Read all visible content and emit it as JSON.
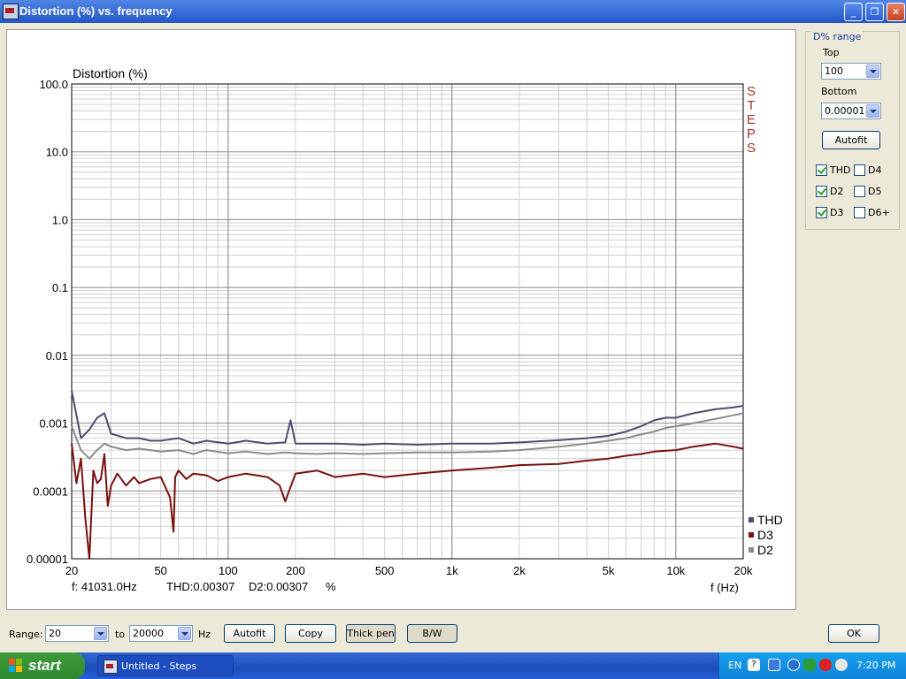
{
  "window": {
    "title": "Distortion (%) vs. frequency"
  },
  "plot": {
    "vertical_watermark": [
      "S",
      "T",
      "E",
      "P",
      "S"
    ],
    "status_freq": "f: 41031.0Hz",
    "status_thd": "THD:0.00307",
    "status_d2": "D2:0.00307",
    "status_unit": "%",
    "legend": [
      {
        "name": "THD",
        "color": "#4b4e6e"
      },
      {
        "name": "D3",
        "color": "#7a1010"
      },
      {
        "name": "D2",
        "color": "#8c8c8c"
      }
    ]
  },
  "chart_data": {
    "type": "line",
    "title": "",
    "ylabel": "Distortion (%)",
    "xlabel": "f (Hz)",
    "x_scale": "log",
    "y_scale": "log",
    "xlim": [
      20,
      20000
    ],
    "ylim": [
      1e-05,
      100
    ],
    "grid": true,
    "legend_position": "bottom-right",
    "x_ticks": [
      {
        "v": 20,
        "label": "20"
      },
      {
        "v": 50,
        "label": "50"
      },
      {
        "v": 100,
        "label": "100"
      },
      {
        "v": 200,
        "label": "200"
      },
      {
        "v": 500,
        "label": "500"
      },
      {
        "v": 1000,
        "label": "1k"
      },
      {
        "v": 2000,
        "label": "2k"
      },
      {
        "v": 5000,
        "label": "5k"
      },
      {
        "v": 10000,
        "label": "10k"
      },
      {
        "v": 20000,
        "label": "20k"
      }
    ],
    "y_ticks": [
      {
        "v": 100,
        "label": "100.0"
      },
      {
        "v": 10,
        "label": "10.0"
      },
      {
        "v": 1,
        "label": "1.0"
      },
      {
        "v": 0.1,
        "label": "0.1"
      },
      {
        "v": 0.01,
        "label": "0.01"
      },
      {
        "v": 0.001,
        "label": "0.001"
      },
      {
        "v": 0.0001,
        "label": "0.0001"
      },
      {
        "v": 1e-05,
        "label": "0.00001"
      }
    ],
    "series": [
      {
        "name": "D2",
        "color": "#8c8c8c",
        "x": [
          20,
          22,
          24,
          26,
          28,
          30,
          35,
          40,
          45,
          50,
          60,
          70,
          80,
          100,
          120,
          150,
          180,
          200,
          250,
          300,
          400,
          500,
          700,
          1000,
          1500,
          2000,
          3000,
          4000,
          5000,
          6000,
          7000,
          8000,
          9000,
          10000,
          12000,
          15000,
          18000,
          20000
        ],
        "y": [
          0.0009,
          0.0004,
          0.0003,
          0.0004,
          0.0005,
          0.00045,
          0.0004,
          0.00042,
          0.0004,
          0.00038,
          0.0004,
          0.00035,
          0.0004,
          0.00036,
          0.00038,
          0.00035,
          0.00037,
          0.00036,
          0.00035,
          0.00036,
          0.00035,
          0.00036,
          0.00037,
          0.00037,
          0.00038,
          0.0004,
          0.00045,
          0.0005,
          0.00055,
          0.0006,
          0.00068,
          0.00075,
          0.00085,
          0.0009,
          0.001,
          0.00115,
          0.0013,
          0.0014
        ]
      },
      {
        "name": "THD",
        "color": "#4b4e6e",
        "x": [
          20,
          22,
          24,
          26,
          28,
          30,
          35,
          40,
          45,
          50,
          60,
          70,
          80,
          100,
          120,
          150,
          180,
          190,
          200,
          250,
          300,
          400,
          500,
          700,
          1000,
          1500,
          2000,
          3000,
          4000,
          5000,
          6000,
          7000,
          8000,
          9000,
          10000,
          12000,
          15000,
          18000,
          20000
        ],
        "y": [
          0.003,
          0.0006,
          0.0008,
          0.0012,
          0.0014,
          0.0007,
          0.0006,
          0.0006,
          0.00055,
          0.00055,
          0.0006,
          0.0005,
          0.00055,
          0.0005,
          0.00055,
          0.0005,
          0.00052,
          0.0011,
          0.0005,
          0.0005,
          0.0005,
          0.00048,
          0.0005,
          0.00048,
          0.0005,
          0.0005,
          0.00052,
          0.00056,
          0.0006,
          0.00065,
          0.00075,
          0.0009,
          0.0011,
          0.0012,
          0.0012,
          0.0014,
          0.0016,
          0.0017,
          0.0018
        ]
      },
      {
        "name": "D3",
        "color": "#7a1010",
        "x": [
          20,
          21,
          22,
          23,
          24,
          25,
          26,
          27,
          28,
          29,
          30,
          32,
          35,
          38,
          40,
          45,
          50,
          55,
          57,
          58,
          60,
          65,
          70,
          80,
          90,
          100,
          120,
          150,
          170,
          180,
          200,
          250,
          300,
          400,
          500,
          700,
          1000,
          1500,
          2000,
          3000,
          4000,
          5000,
          6000,
          7000,
          8000,
          10000,
          12000,
          15000,
          18000,
          20000
        ],
        "y": [
          0.0005,
          0.00013,
          0.0003,
          4e-05,
          1e-05,
          0.0002,
          0.00013,
          0.00015,
          0.00035,
          6e-05,
          0.00012,
          0.00018,
          0.00012,
          0.00016,
          0.00013,
          0.00015,
          0.00016,
          8e-05,
          2.5e-05,
          0.00016,
          0.0002,
          0.00015,
          0.00018,
          0.00017,
          0.00014,
          0.00016,
          0.00018,
          0.00016,
          0.00012,
          7e-05,
          0.00018,
          0.0002,
          0.00016,
          0.00018,
          0.00016,
          0.00018,
          0.0002,
          0.00022,
          0.00024,
          0.00025,
          0.00028,
          0.0003,
          0.00033,
          0.00035,
          0.00038,
          0.0004,
          0.00045,
          0.0005,
          0.00045,
          0.00042
        ]
      }
    ]
  },
  "range_panel": {
    "title": "D% range",
    "top_label": "Top",
    "top_value": "100",
    "bottom_label": "Bottom",
    "bottom_value": "0.00001",
    "autofit_label": "Autofit",
    "checks": [
      {
        "label": "THD",
        "checked": true
      },
      {
        "label": "D4",
        "checked": false
      },
      {
        "label": "D2",
        "checked": true
      },
      {
        "label": "D5",
        "checked": false
      },
      {
        "label": "D3",
        "checked": true
      },
      {
        "label": "D6+",
        "checked": false
      }
    ]
  },
  "bottom_bar": {
    "range_label": "Range:",
    "from_value": "20",
    "to_label": "to",
    "to_value": "20000",
    "hz_label": "Hz",
    "autofit": "Autofit",
    "copy": "Copy",
    "thick_pen": "Thick pen",
    "bw": "B/W",
    "ok": "OK"
  },
  "taskbar": {
    "start": "start",
    "task_item": "Untitled - Steps",
    "language": "EN",
    "clock": "7:20 PM"
  }
}
